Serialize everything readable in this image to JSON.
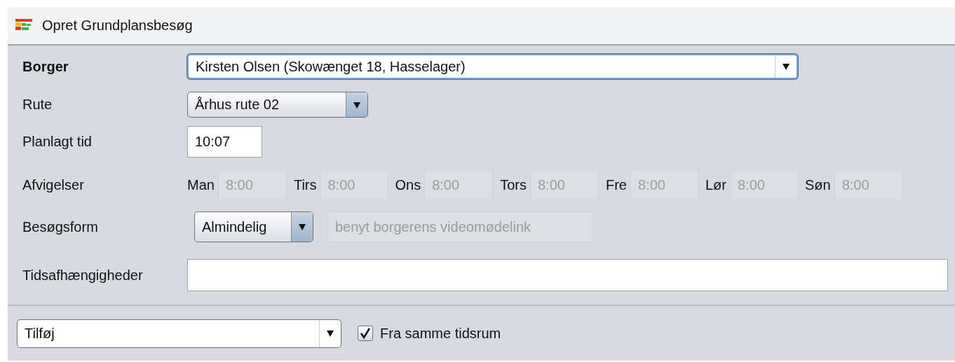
{
  "window": {
    "title": "Opret Grundplansbesøg"
  },
  "borger": {
    "label": "Borger",
    "value": "Kirsten Olsen (Skowænget 18, Hasselager)",
    "focused": true
  },
  "rute": {
    "label": "Rute",
    "value": "Århus rute 02"
  },
  "planlagt_tid": {
    "label": "Planlagt tid",
    "value": "10:07"
  },
  "afvigelser": {
    "label": "Afvigelser",
    "days": [
      {
        "day": "Man",
        "value": "8:00",
        "disabled": true
      },
      {
        "day": "Tirs",
        "value": "8:00",
        "disabled": true
      },
      {
        "day": "Ons",
        "value": "8:00",
        "disabled": true
      },
      {
        "day": "Tors",
        "value": "8:00",
        "disabled": true
      },
      {
        "day": "Fre",
        "value": "8:00",
        "disabled": true
      },
      {
        "day": "Lør",
        "value": "8:00",
        "disabled": true
      },
      {
        "day": "Søn",
        "value": "8:00",
        "disabled": true
      }
    ]
  },
  "besoegsform": {
    "label": "Besøgsform",
    "value": "Almindelig",
    "video_link": {
      "placeholder": "benyt borgerens videomødelink",
      "disabled": true
    }
  },
  "tidsafhaengigheder": {
    "label": "Tidsafhængigheder"
  },
  "footer": {
    "add": {
      "value": "Tilføj"
    },
    "same_period": {
      "label": "Fra samme tidsrum",
      "checked": true
    }
  }
}
